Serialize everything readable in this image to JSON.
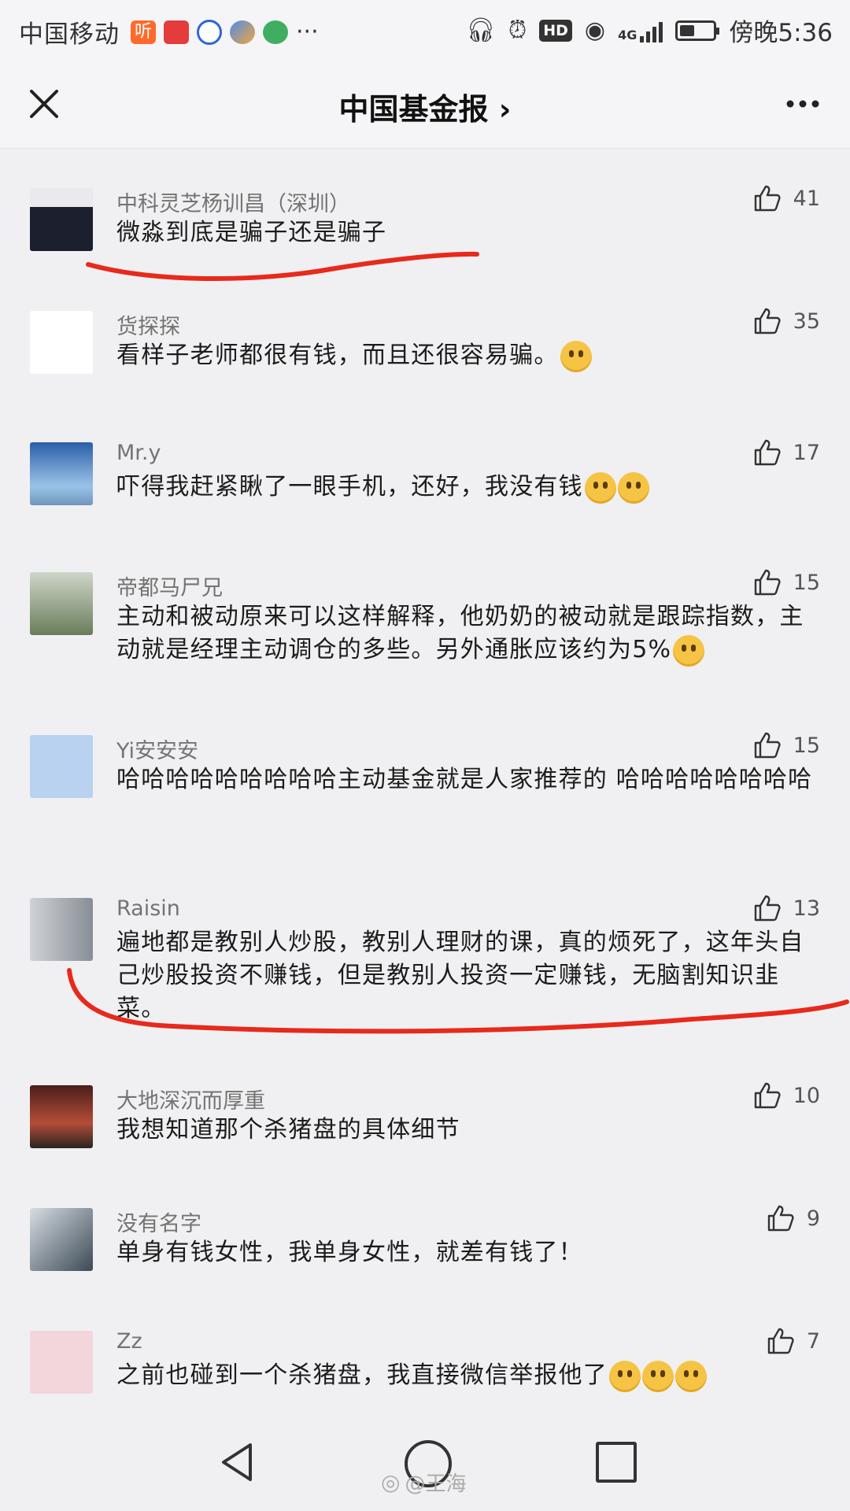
{
  "statusbar": {
    "carrier": "中国移动",
    "time": "傍晚5:36",
    "hd": "HD",
    "network": "4G",
    "battery_level": 0.45,
    "app_icons": [
      "听",
      "华安证券",
      "baidu",
      "app",
      "weibo"
    ]
  },
  "nav": {
    "title": "中国基金报 ›"
  },
  "comments": [
    {
      "author": "中科灵芝杨训昌（深圳）",
      "text": "微淼到底是骗子还是骗子",
      "likes": "41",
      "emojis": 0
    },
    {
      "author": "货探探",
      "text": "看样子老师都很有钱，而且还很容易骗。",
      "likes": "35",
      "emojis": 1
    },
    {
      "author": "Mr.y",
      "text": "吓得我赶紧瞅了一眼手机，还好，我没有钱",
      "likes": "17",
      "emojis": 2
    },
    {
      "author": "帝都马尸兄",
      "text": "主动和被动原来可以这样解释，他奶奶的被动就是跟踪指数，主动就是经理主动调仓的多些。另外通胀应该约为5%",
      "likes": "15",
      "emojis": 1
    },
    {
      "author": "Yi安安安",
      "text": "哈哈哈哈哈哈哈哈哈主动基金就是人家推荐的 哈哈哈哈哈哈哈哈",
      "likes": "15",
      "emojis": 0
    },
    {
      "author": "Raisin",
      "text": "遍地都是教别人炒股，教别人理财的课，真的烦死了，这年头自己炒股投资不赚钱，但是教别人投资一定赚钱，无脑割知识韭菜。",
      "likes": "13",
      "emojis": 0
    },
    {
      "author": "大地深沉而厚重",
      "text": "我想知道那个杀猪盘的具体细节",
      "likes": "10",
      "emojis": 0
    },
    {
      "author": "没有名字",
      "text": "单身有钱女性，我单身女性，就差有钱了！",
      "likes": "9",
      "emojis": 0
    },
    {
      "author": "Zz",
      "text": "之前也碰到一个杀猪盘，我直接微信举报他了",
      "likes": "7",
      "emojis": 3
    }
  ],
  "watermark": "@王海",
  "colors": {
    "annotation": "#e8291c",
    "background": "#f0f0f2"
  }
}
